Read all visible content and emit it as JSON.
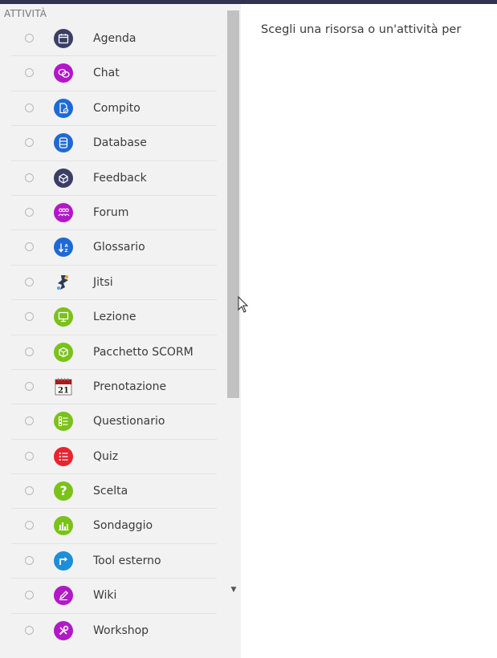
{
  "section_title": "ATTIVITÀ",
  "main_text": "Scegli una risorsa o un'attività per",
  "activities": [
    {
      "label": "Agenda",
      "icon": "calendar-icon",
      "color": "#3b3f66"
    },
    {
      "label": "Chat",
      "icon": "chat-bubbles-icon",
      "color": "#b218c8"
    },
    {
      "label": "Compito",
      "icon": "assignment-icon",
      "color": "#1d6ad6"
    },
    {
      "label": "Database",
      "icon": "database-icon",
      "color": "#1d6ad6"
    },
    {
      "label": "Feedback",
      "icon": "feedback-box-icon",
      "color": "#3b3f66"
    },
    {
      "label": "Forum",
      "icon": "forum-people-icon",
      "color": "#b218c8"
    },
    {
      "label": "Glossario",
      "icon": "glossary-sort-icon",
      "color": "#1d6ad6"
    },
    {
      "label": "Jitsi",
      "icon": "jitsi-logo-icon",
      "color": "#2f3a55"
    },
    {
      "label": "Lezione",
      "icon": "lesson-board-icon",
      "color": "#7ac21a"
    },
    {
      "label": "Pacchetto SCORM",
      "icon": "scorm-package-icon",
      "color": "#7ac21a"
    },
    {
      "label": "Prenotazione",
      "icon": "calendar-page-icon",
      "color": "#b01818",
      "badge": "21"
    },
    {
      "label": "Questionario",
      "icon": "questionnaire-list-icon",
      "color": "#7ac21a"
    },
    {
      "label": "Quiz",
      "icon": "quiz-list-icon",
      "color": "#e8242e"
    },
    {
      "label": "Scelta",
      "icon": "question-mark-icon",
      "color": "#7ac21a",
      "glyph": "?"
    },
    {
      "label": "Sondaggio",
      "icon": "bar-chart-icon",
      "color": "#7ac21a"
    },
    {
      "label": "Tool esterno",
      "icon": "external-tool-icon",
      "color": "#1d8fd6"
    },
    {
      "label": "Wiki",
      "icon": "wiki-pen-icon",
      "color": "#b218c8"
    },
    {
      "label": "Workshop",
      "icon": "workshop-tools-icon",
      "color": "#b218c8"
    }
  ]
}
